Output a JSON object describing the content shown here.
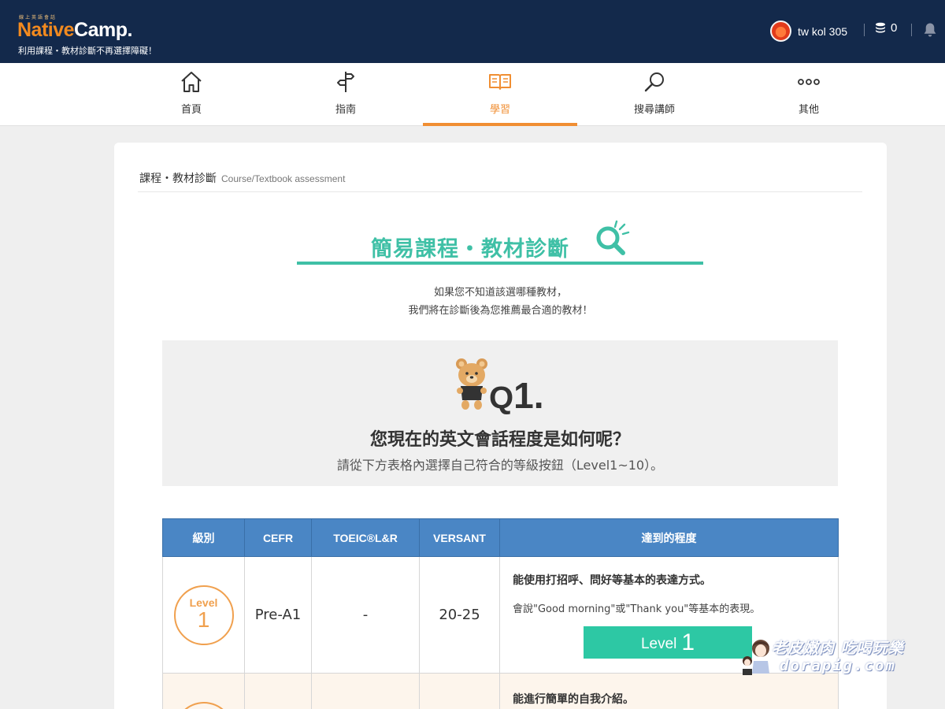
{
  "header": {
    "logo_small": "線上英語會話",
    "logo_native": "Native",
    "logo_camp": "Camp.",
    "tagline": "利用課程・教材診斷不再選擇障礙！",
    "username": "tw kol 305",
    "coins": "0",
    "colors": {
      "bg": "#13294b",
      "accent": "#f28a1f"
    }
  },
  "nav": {
    "items": [
      {
        "label": "首頁",
        "icon": "home-icon"
      },
      {
        "label": "指南",
        "icon": "signpost-icon"
      },
      {
        "label": "學習",
        "icon": "book-icon",
        "active": true
      },
      {
        "label": "搜尋講師",
        "icon": "search-icon"
      },
      {
        "label": "其他",
        "icon": "more-icon"
      }
    ]
  },
  "breadcrumb": {
    "title": "課程・教材診斷",
    "en": "Course/Textbook assessment"
  },
  "page": {
    "title": "簡易課程・教材診斷",
    "intro_line1": "如果您不知道該選哪種教材，",
    "intro_line2": "我們將在診斷後為您推薦最合適的教材！",
    "accent": "#3fc0a6"
  },
  "question": {
    "q_letter": "Q",
    "q_number": "1.",
    "title": "您現在的英文會話程度是如何呢？",
    "subtitle": "請從下方表格內選擇自己符合的等級按鈕（Level1~10）。"
  },
  "table": {
    "headers": [
      "級別",
      "CEFR",
      "TOEIC®L&R",
      "VERSANT",
      "達到的程度"
    ],
    "rows": [
      {
        "level_word": "Level",
        "level_num": "1",
        "cefr": "Pre-A1",
        "toeic": "-",
        "versant": "20-25",
        "main": "能使用打招呼、問好等基本的表達方式。",
        "sub": "會說\"Good morning\"或\"Thank you\"等基本的表現。",
        "button_word": "Level",
        "button_num": "1"
      },
      {
        "main": "能進行簡單的自我介紹。"
      }
    ]
  },
  "watermark": {
    "line1": "老皮嫩肉 吃喝玩樂",
    "line2": "dorapig.com"
  }
}
